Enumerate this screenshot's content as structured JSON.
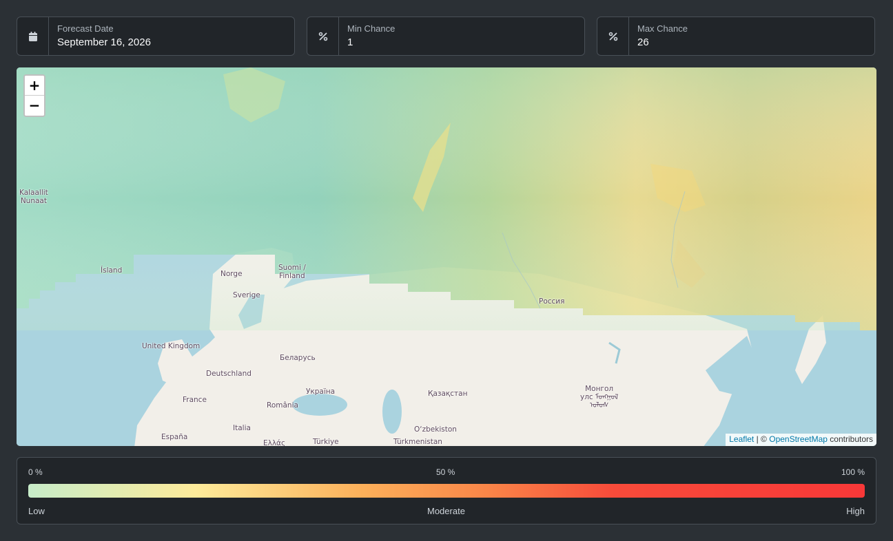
{
  "cards": {
    "forecast": {
      "label": "Forecast Date",
      "value": "September 16, 2026",
      "icon": "calendar-icon"
    },
    "min": {
      "label": "Min Chance",
      "value": "1",
      "icon": "percent-icon"
    },
    "max": {
      "label": "Max Chance",
      "value": "26",
      "icon": "percent-icon"
    }
  },
  "map": {
    "zoom_in": "+",
    "zoom_out": "−",
    "attribution": {
      "leaflet": "Leaflet",
      "sep": "| ©",
      "osm": "OpenStreetMap",
      "contributors": "contributors"
    },
    "places": {
      "kalaallit": "Kalaallit\nNunaat",
      "island": "Ísland",
      "norge": "Norge",
      "suomi": "Suomi /\nFinland",
      "sverige": "Sverige",
      "rossiya": "Россия",
      "uk": "United Kingdom",
      "belarus": "Беларусь",
      "deutschland": "Deutschland",
      "ukraina": "Україна",
      "kazakhstan": "Қазақстан",
      "mongol": "Монгол\nулс ᠮᠣᠩᠭᠣᠯ\nᠤᠯᠤᠰ",
      "france": "France",
      "romania": "România",
      "ozbekiston": "O‘zbekiston",
      "espana": "España",
      "italia": "Italia",
      "ellas": "Ελλάς",
      "turkiye": "Türkiye",
      "turkmenistan": "Türkmenistan"
    },
    "colors": {
      "ocean": "#aad3df",
      "land": "#f2efe9",
      "low": "#c7ecc9",
      "mid": "#fde18a",
      "high": "#f7c96a"
    }
  },
  "legend": {
    "pct_low": "0 %",
    "pct_mid": "50 %",
    "pct_high": "100 %",
    "low": "Low",
    "moderate": "Moderate",
    "high": "High",
    "gradient": [
      "#c7ecc9",
      "#fdeb9a",
      "#fcb05a",
      "#f98548",
      "#f84b3a",
      "#f83838"
    ]
  }
}
